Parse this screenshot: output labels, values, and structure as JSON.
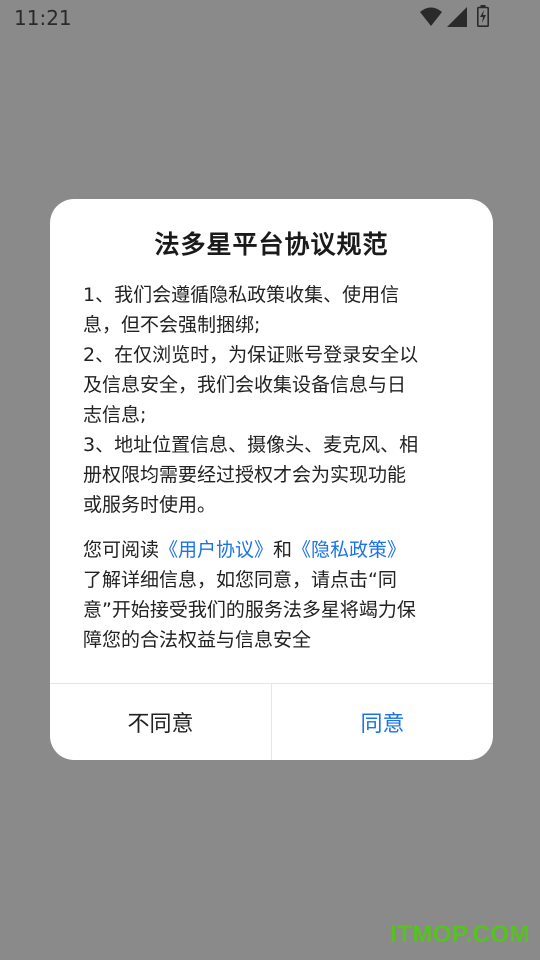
{
  "status_bar": {
    "time": "11:21",
    "icons": [
      "wifi-icon",
      "cell-signal-icon",
      "battery-charging-icon"
    ]
  },
  "dialog": {
    "title": "法多星平台协议规范",
    "policy_lines": [
      "1、我们会遵循隐私政策收集、使用信",
      "息，但不会强制捆绑;",
      "2、在仅浏览时，为保证账号登录安全以",
      "及信息安全，我们会收集设备信息与日",
      "志信息;",
      "3、地址位置信息、摄像头、麦克风、相",
      "册权限均需要经过授权才会为实现功能",
      "或服务时使用。"
    ],
    "intro": {
      "prefix": "您可阅读",
      "user_agreement_link": "《用户协议》",
      "and": "和",
      "privacy_policy_link": "《隐私政策》",
      "lines": [
        "了解详细信息，如您同意，请点击“同",
        "意”开始接受我们的服务法多星将竭力保",
        "障您的合法权益与信息安全"
      ]
    },
    "buttons": {
      "disagree": "不同意",
      "agree": "同意"
    },
    "colors": {
      "link": "#1a73e8",
      "overlay": "#8a8a8a"
    }
  },
  "watermark": {
    "text": "ITMOP.COM",
    "color": "#57c21f"
  }
}
